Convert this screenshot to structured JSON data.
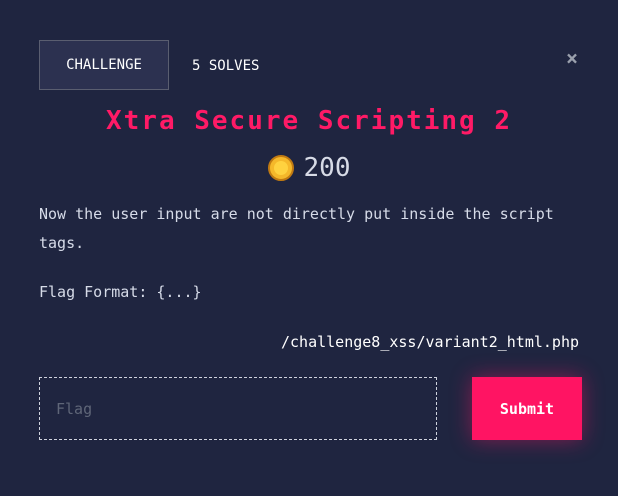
{
  "tabs": {
    "challenge": "CHALLENGE",
    "solves": "5 SOLVES"
  },
  "close_icon": "×",
  "challenge": {
    "title": "Xtra Secure Scripting 2",
    "points": "200",
    "description": "Now the user input are not directly put inside the script tags.",
    "flag_format": "Flag Format: {...}",
    "link": "/challenge8_xss/variant2_html.php"
  },
  "form": {
    "placeholder": "Flag",
    "submit_label": "Submit"
  },
  "colors": {
    "accent": "#ff1463",
    "background": "#1f2540",
    "coin": "#f5b82a"
  }
}
